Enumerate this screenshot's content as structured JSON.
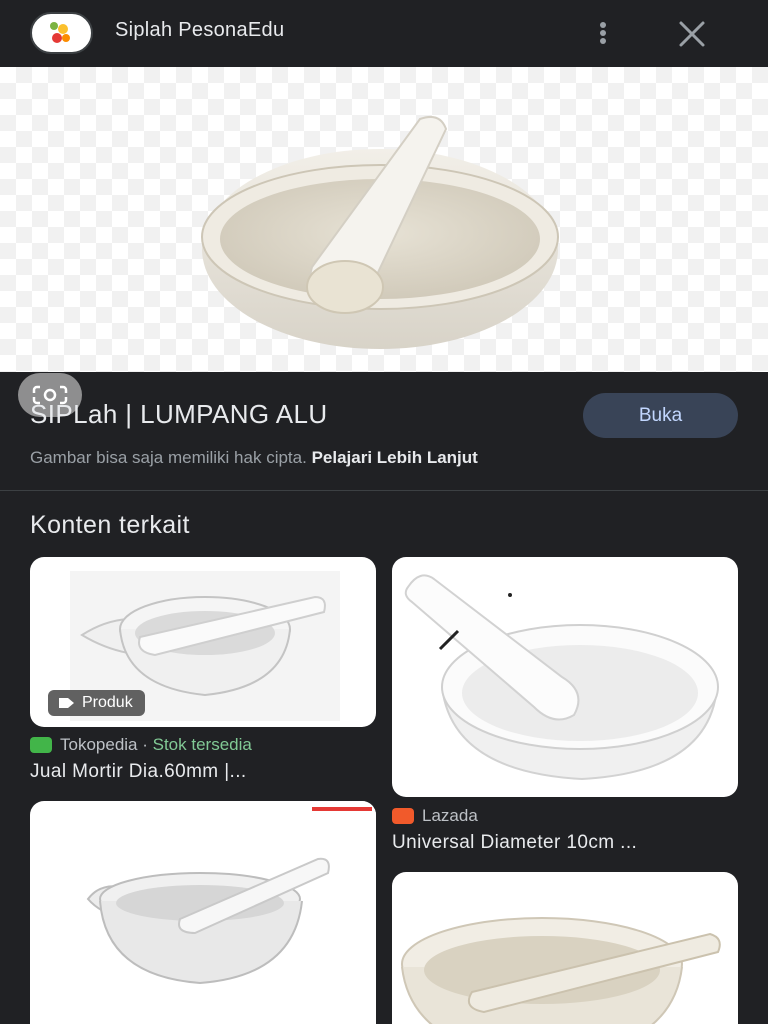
{
  "header": {
    "site_name": "Siplah PesonaEdu",
    "more_icon": "more-vert-icon",
    "close_icon": "close-icon"
  },
  "preview": {
    "image_alt": "mortar and pestle",
    "lens_icon": "lens-icon"
  },
  "info": {
    "title": "SIPLah | LUMPANG ALU",
    "open_button": "Buka",
    "copyright_text": "Gambar bisa saja memiliki hak cipta.",
    "learn_more": "Pelajari Lebih Lanjut"
  },
  "related": {
    "heading": "Konten terkait",
    "items": [
      {
        "badge": "Produk",
        "source": "Tokopedia",
        "separator": " · ",
        "stock": "Stok tersedia",
        "caption": "Jual Mortir Dia.60mm |..."
      },
      {
        "source": "Lazada",
        "caption": "Universal Diameter 10cm ..."
      },
      {
        "source": "",
        "caption": ""
      },
      {
        "source": "",
        "caption": ""
      }
    ]
  },
  "colors": {
    "background": "#202124",
    "accent_button": "#394457",
    "accent_text": "#c2d7ff",
    "stock_green": "#81c995"
  }
}
